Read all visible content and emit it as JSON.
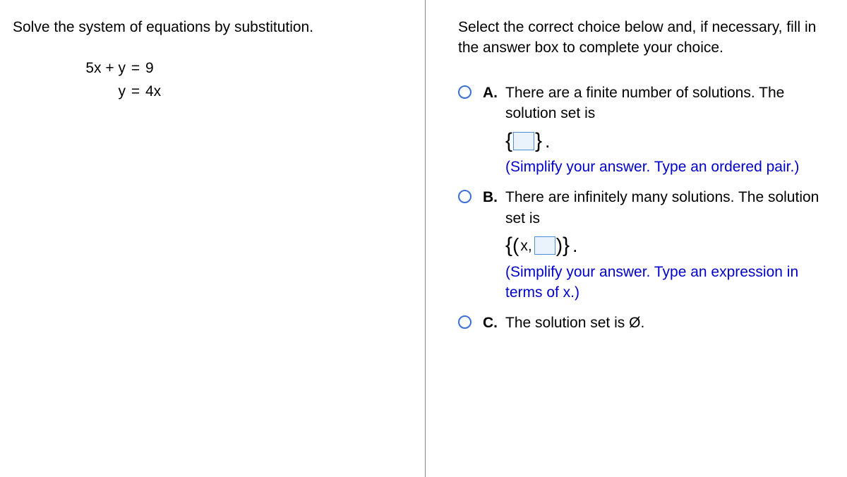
{
  "left": {
    "prompt": "Solve the system of equations by substitution.",
    "eq1_left": "5x + y",
    "eq1_mid": "=",
    "eq1_right": "9",
    "eq2_left": "y",
    "eq2_mid": "=",
    "eq2_right": "4x"
  },
  "right": {
    "instructions": "Select the correct choice below and, if necessary, fill in the answer box to complete your choice.",
    "choices": {
      "a": {
        "label": "A.",
        "text1": "There are a finite number of solutions. The solution set is",
        "open_brace": "{",
        "close_brace": "}",
        "period": ".",
        "hint": "(Simplify your answer. Type an ordered pair.)"
      },
      "b": {
        "label": "B.",
        "text1": "There are infinitely many solutions. The solution set is",
        "open_brace": "{",
        "open_paren": "(",
        "x_comma": "x,",
        "close_paren": ")",
        "close_brace": "}",
        "period": ".",
        "hint": "(Simplify your answer. Type an expression in terms of x.)"
      },
      "c": {
        "label": "C.",
        "text1": "The solution set is ",
        "empty": "Ø",
        "period": "."
      }
    }
  }
}
